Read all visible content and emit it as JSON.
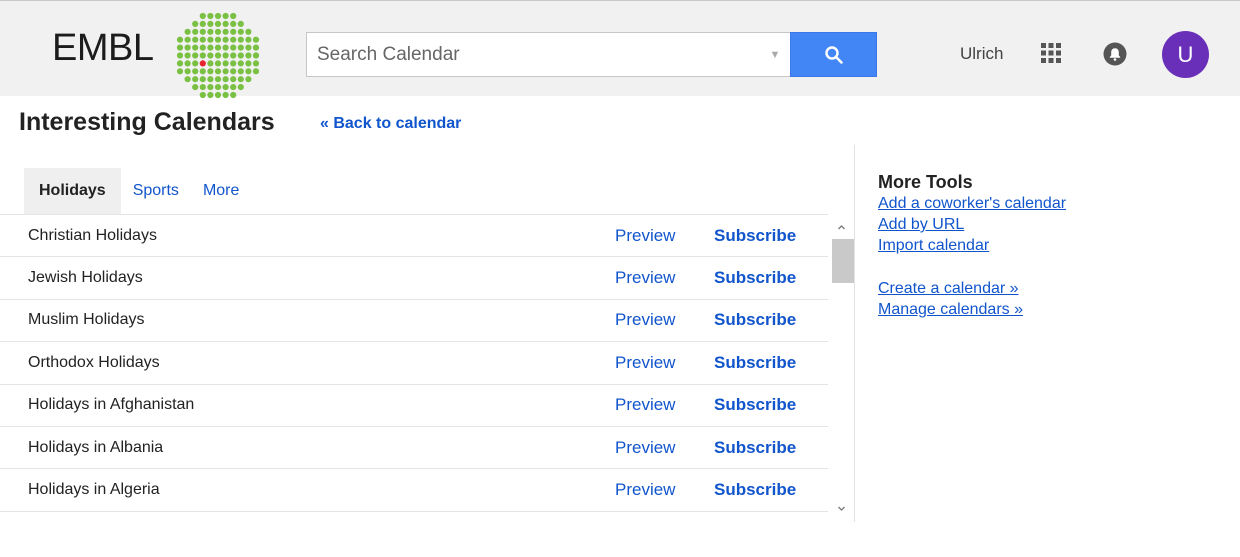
{
  "header": {
    "logo_text": "EMBL",
    "search": {
      "placeholder": "Search Calendar",
      "value": ""
    },
    "user_name": "Ulrich",
    "avatar_letter": "U",
    "colors": {
      "search_button": "#4285f4",
      "avatar": "#6a2fb8",
      "logo_green": "#7ac143",
      "logo_red": "#e5262f"
    }
  },
  "page": {
    "title": "Interesting Calendars",
    "back_link": "« Back to calendar"
  },
  "tabs": [
    {
      "label": "Holidays",
      "active": true
    },
    {
      "label": "Sports",
      "active": false
    },
    {
      "label": "More",
      "active": false
    }
  ],
  "calendars": [
    {
      "name": "Christian Holidays",
      "preview": "Preview",
      "subscribe": "Subscribe"
    },
    {
      "name": "Jewish Holidays",
      "preview": "Preview",
      "subscribe": "Subscribe"
    },
    {
      "name": "Muslim Holidays",
      "preview": "Preview",
      "subscribe": "Subscribe"
    },
    {
      "name": "Orthodox Holidays",
      "preview": "Preview",
      "subscribe": "Subscribe"
    },
    {
      "name": "Holidays in Afghanistan",
      "preview": "Preview",
      "subscribe": "Subscribe"
    },
    {
      "name": "Holidays in Albania",
      "preview": "Preview",
      "subscribe": "Subscribe"
    },
    {
      "name": "Holidays in Algeria",
      "preview": "Preview",
      "subscribe": "Subscribe"
    }
  ],
  "more_tools": {
    "title": "More Tools",
    "links_group1": [
      "Add a coworker's calendar",
      "Add by URL",
      "Import calendar"
    ],
    "links_group2": [
      "Create a calendar »",
      "Manage calendars »"
    ]
  },
  "icons": {
    "search": "search-icon",
    "apps": "apps-grid-icon",
    "notifications": "bell-icon",
    "dropdown": "chevron-down-icon",
    "scroll_up": "chevron-up-icon",
    "scroll_down": "chevron-down-icon"
  }
}
